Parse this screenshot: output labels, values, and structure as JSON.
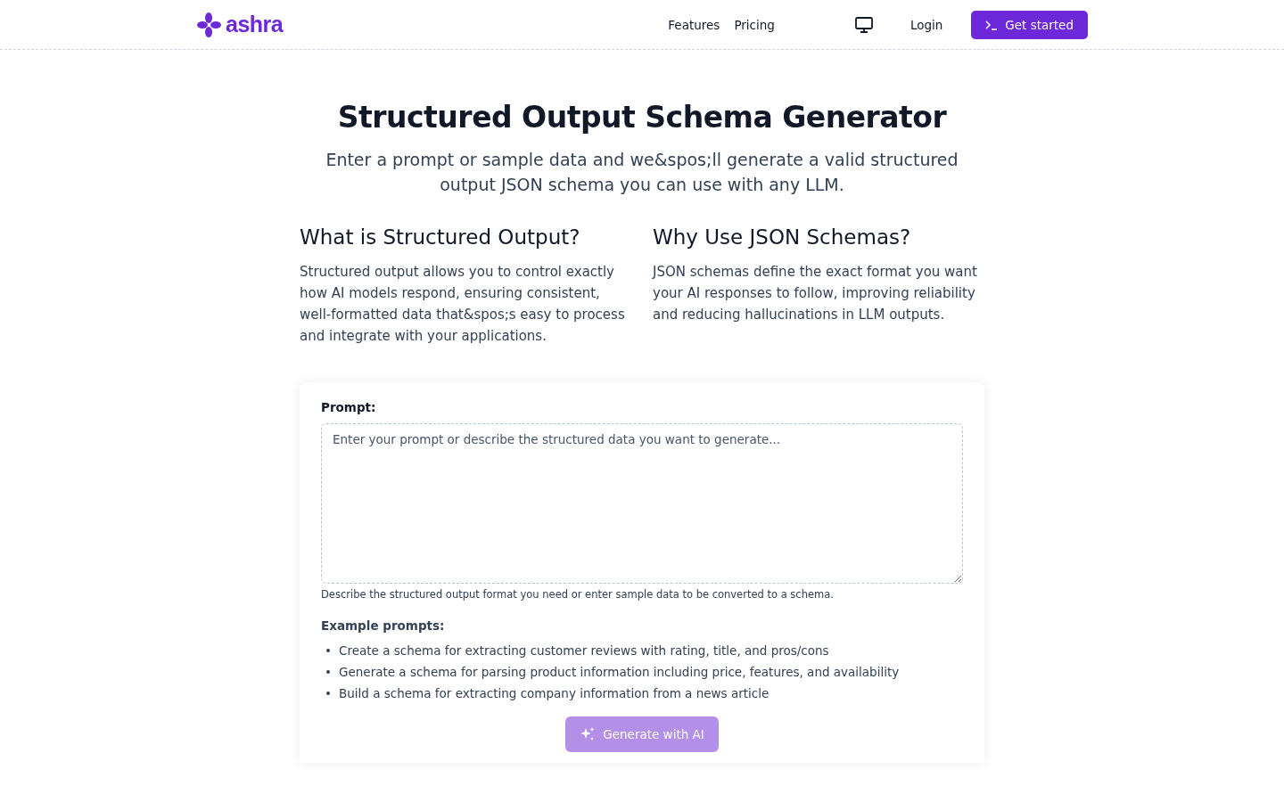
{
  "header": {
    "logo": "ashra",
    "nav": [
      "Features",
      "Pricing"
    ],
    "login": "Login",
    "cta": "Get started"
  },
  "hero": {
    "title": "Structured Output Schema Generator",
    "subtitle": "Enter a prompt or sample data and we&spos;ll generate a valid structured output JSON schema you can use with any LLM."
  },
  "info": [
    {
      "heading": "What is Structured Output?",
      "text": "Structured output allows you to control exactly how AI models respond, ensuring consistent, well-formatted data that&spos;s easy to process and integrate with your applications."
    },
    {
      "heading": "Why Use JSON Schemas?",
      "text": "JSON schemas define the exact format you want your AI responses to follow, improving reliability and reducing hallucinations in LLM outputs."
    }
  ],
  "form": {
    "label": "Prompt:",
    "placeholder": "Enter your prompt or describe the structured data you want to generate...",
    "hint": "Describe the structured output format you need or enter sample data to be converted to a schema.",
    "examples_label": "Example prompts:",
    "examples": [
      "Create a schema for extracting customer reviews with rating, title, and pros/cons",
      "Generate a schema for parsing product information including price, features, and availability",
      "Build a schema for extracting company information from a news article"
    ],
    "button": {
      "label": "Generate with AI",
      "disabled": true
    }
  }
}
